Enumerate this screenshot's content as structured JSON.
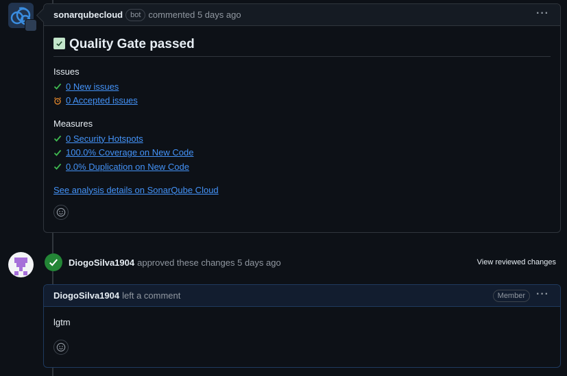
{
  "comment1": {
    "author": "sonarqubecloud",
    "badge": "bot",
    "action": "commented 5 days ago",
    "title": "Quality Gate passed",
    "issues_label": "Issues",
    "issues": [
      {
        "icon": "check-icon",
        "text": "0 New issues"
      },
      {
        "icon": "alarm-icon",
        "text": "0 Accepted issues"
      }
    ],
    "measures_label": "Measures",
    "measures": [
      {
        "icon": "check-icon",
        "text": "0 Security Hotspots"
      },
      {
        "icon": "check-icon",
        "text": "100.0% Coverage on New Code"
      },
      {
        "icon": "check-icon",
        "text": "0.0% Duplication on New Code"
      }
    ],
    "analysis_link": "See analysis details on SonarQube Cloud"
  },
  "review": {
    "author": "DiogoSilva1904",
    "action": "approved these changes 5 days ago",
    "view_changes": "View reviewed changes"
  },
  "comment2": {
    "author": "DiogoSilva1904",
    "action": "left a comment",
    "badge": "Member",
    "body": "lgtm"
  },
  "colors": {
    "link": "#4493f8",
    "success": "#238636",
    "check": "#3fb950"
  }
}
